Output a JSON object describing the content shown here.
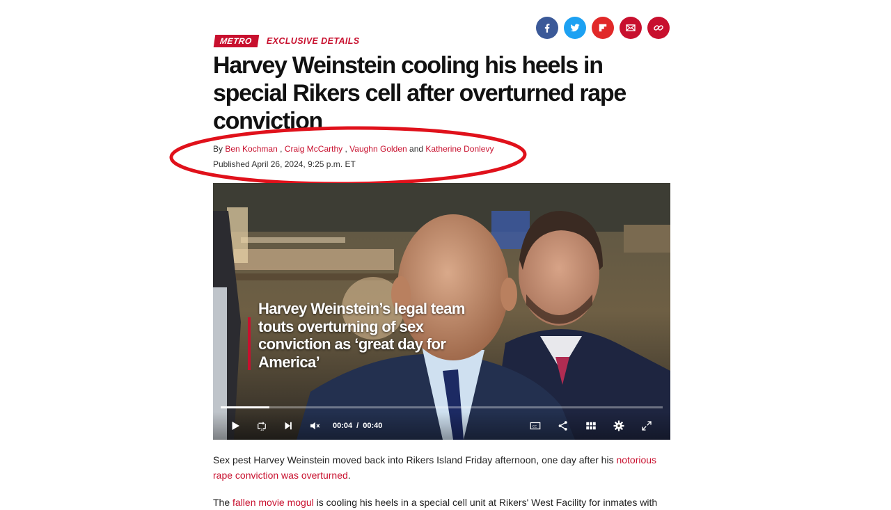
{
  "share": {
    "buttons": [
      {
        "name": "facebook",
        "color": "#3b5998",
        "icon": "facebook-icon"
      },
      {
        "name": "twitter",
        "color": "#1da1f2",
        "icon": "twitter-icon"
      },
      {
        "name": "flipboard",
        "color": "#e12828",
        "icon": "flipboard-icon"
      },
      {
        "name": "email",
        "color": "#c8102e",
        "icon": "mail-icon"
      },
      {
        "name": "copy-link",
        "color": "#c8102e",
        "icon": "link-icon"
      }
    ]
  },
  "article": {
    "section": "METRO",
    "kicker": "EXCLUSIVE DETAILS",
    "headline": "Harvey Weinstein cooling his heels in special Rikers cell after overturned rape conviction",
    "byline": {
      "prefix": "By",
      "authors": [
        "Ben Kochman",
        "Craig McCarthy",
        "Vaughn Golden",
        "Katherine Donlevy"
      ],
      "sep": ",",
      "and": "and"
    },
    "published": "Published April 26, 2024, 9:25 p.m. ET",
    "accent_color": "#c8102e",
    "annotation_color": "#e0111b"
  },
  "video": {
    "caption": "Harvey Weinstein’s legal team touts overturning of sex conviction as ‘great day for America’",
    "current_time": "00:04",
    "time_separator": "/",
    "duration": "00:40",
    "progress": 0.11,
    "controls": [
      "play-icon",
      "replay-10-icon",
      "skip-next-icon",
      "mute-icon",
      "captions-icon",
      "share-icon",
      "grid-icon",
      "settings-icon",
      "fullscreen-icon"
    ]
  },
  "body": {
    "p1_text": "Sex pest Harvey Weinstein moved back into Rikers Island Friday afternoon, one day after his ",
    "p1_link": "notorious rape conviction was overturned",
    "p1_end": ".",
    "p2_start": "The ",
    "p2_link": "fallen movie mogul",
    "p2_text": " is cooling his heels in a special cell unit at Rikers' West Facility for inmates with"
  }
}
